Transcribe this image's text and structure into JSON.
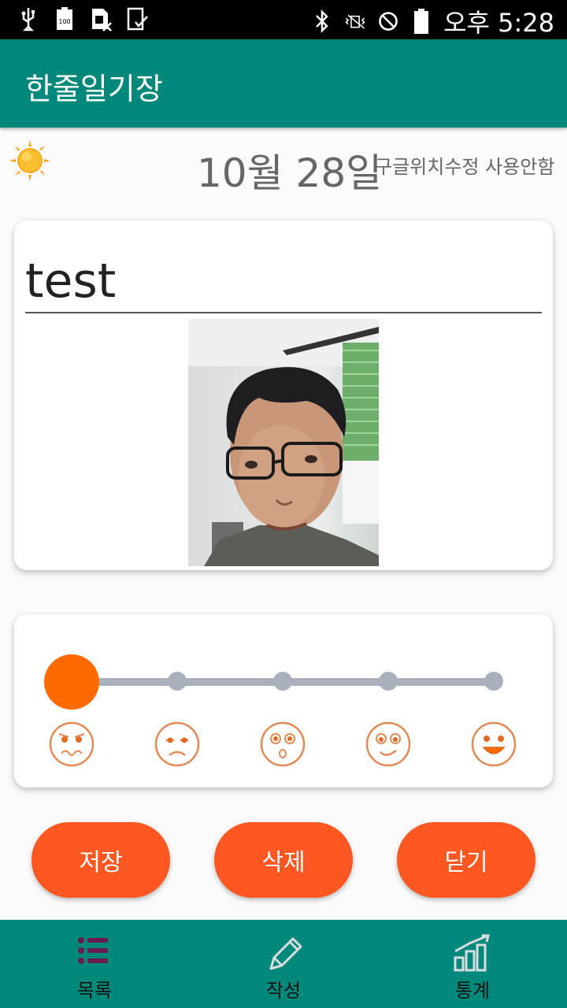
{
  "status_bar": {
    "time": "오후 5:28"
  },
  "app_bar": {
    "title": "한줄일기장"
  },
  "header": {
    "date": "10월 28일",
    "location_status": "구글위치수정 사용안함",
    "weather_icon": "sun-icon"
  },
  "entry": {
    "title_value": "test",
    "photo": "selfie-photo"
  },
  "mood": {
    "levels": [
      "very-sad",
      "sad",
      "surprised",
      "content",
      "happy"
    ],
    "selected_index": 0,
    "accent_color": "#ff6a00"
  },
  "actions": {
    "save_label": "저장",
    "delete_label": "삭제",
    "close_label": "닫기"
  },
  "bottom_nav": {
    "items": [
      {
        "label": "목록",
        "icon": "list-icon"
      },
      {
        "label": "작성",
        "icon": "pencil-icon"
      },
      {
        "label": "통계",
        "icon": "chart-icon"
      }
    ]
  },
  "colors": {
    "primary": "#00897b",
    "button": "#ff5722",
    "list_icon": "#6a1b4d"
  }
}
